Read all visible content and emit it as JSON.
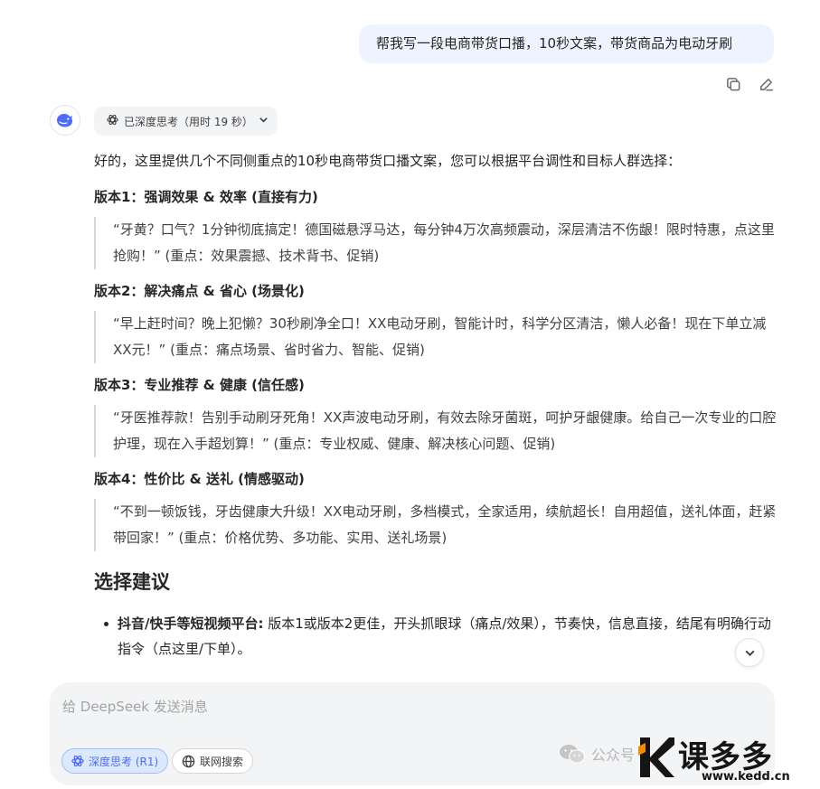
{
  "user_message": "帮我写一段电商带货口播，10秒文案，带货商品为电动牙刷",
  "message_tools": {
    "copy_icon": "copy-icon",
    "edit_icon": "edit-icon"
  },
  "assistant": {
    "avatar_icon": "deepseek-whale-icon",
    "think_chip_label": "已深度思考（用时 19 秒）",
    "intro": "好的，这里提供几个不同侧重点的10秒电商带货口播文案，您可以根据平台调性和目标人群选择：",
    "versions": [
      {
        "title": "版本1：强调效果 & 效率 (直接有力)",
        "quote": "“牙黄？口气？1分钟彻底搞定！德国磁悬浮马达，每分钟4万次高频震动，深层清洁不伤龈！限时特惠，点这里抢购！” (重点：效果震撼、技术背书、促销)"
      },
      {
        "title": "版本2：解决痛点 & 省心 (场景化)",
        "quote": "“早上赶时间？晚上犯懒？30秒刷净全口！XX电动牙刷，智能计时，科学分区清洁，懒人必备！现在下单立减XX元！” (重点：痛点场景、省时省力、智能、促销)"
      },
      {
        "title": "版本3：专业推荐 & 健康 (信任感)",
        "quote": "“牙医推荐款！告别手动刷牙死角！XX声波电动牙刷，有效去除牙菌斑，呵护牙龈健康。给自己一次专业的口腔护理，现在入手超划算！” (重点：专业权威、健康、解决核心问题、促销)"
      },
      {
        "title": "版本4：性价比 & 送礼 (情感驱动)",
        "quote": "“不到一顿饭钱，牙齿健康大升级！XX电动牙刷，多档模式，全家适用，续航超长！自用超值，送礼体面，赶紧带回家！” (重点：价格优势、多功能、实用、送礼场景)"
      }
    ],
    "section_heading": "选择建议",
    "bullets": [
      {
        "label": "抖音/快手等短视频平台:",
        "text": " 版本1或版本2更佳，开头抓眼球（痛点/效果），节奏快，信息直接，结尾有明确行动指令（点这里/下单）。"
      }
    ]
  },
  "composer": {
    "placeholder": "给 DeepSeek 发送消息",
    "deep_think_label": "深度思考 (R1)",
    "web_search_label": "联网搜索"
  },
  "watermark": {
    "wechat_text": "公众号",
    "brand_text": "课多多",
    "brand_url": "www.kedd.cn"
  }
}
